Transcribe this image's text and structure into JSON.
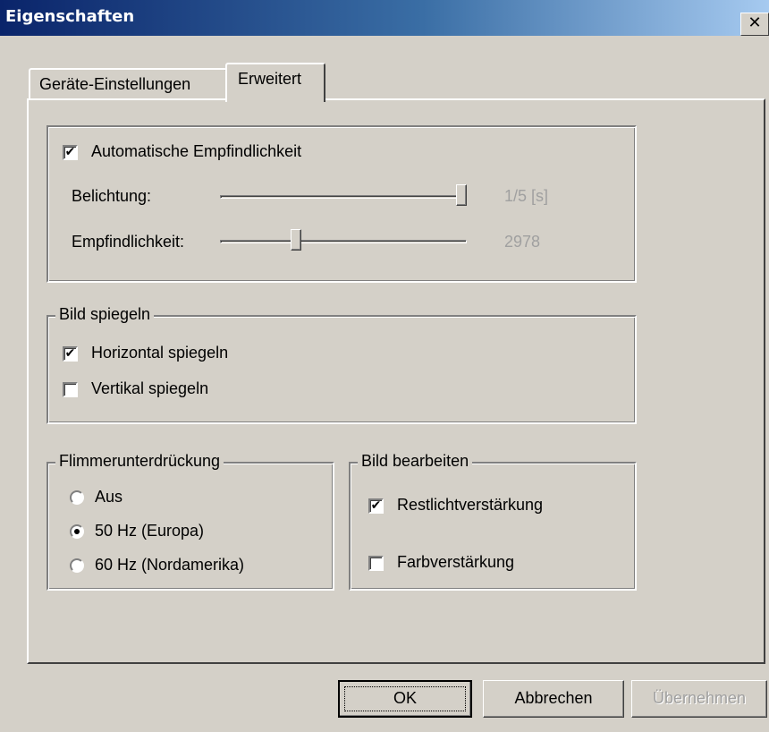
{
  "window": {
    "title": "Eigenschaften",
    "close_glyph": "✕",
    "close_icon": "close-icon"
  },
  "tabs": [
    {
      "label": "Geräte-Einstellungen",
      "active": false
    },
    {
      "label": "Erweitert",
      "active": true
    }
  ],
  "exposure_group": {
    "auto_sensitivity": {
      "label": "Automatische Empfindlichkeit",
      "checked": true,
      "mark": "✔"
    },
    "exposure": {
      "label": "Belichtung:",
      "value": "1/5 [s]",
      "level": 1.0
    },
    "sensitivity": {
      "label": "Empfindlichkeit:",
      "value": "2978",
      "level": 0.3
    }
  },
  "mirror_group": {
    "title": "Bild spiegeln",
    "horizontal": {
      "label": "Horizontal spiegeln",
      "checked": true,
      "mark": "✔"
    },
    "vertical": {
      "label": "Vertikal spiegeln",
      "checked": false,
      "mark": ""
    }
  },
  "flicker_group": {
    "title": "Flimmerunterdrückung",
    "options": [
      {
        "label": "Aus",
        "selected": false
      },
      {
        "label": "50 Hz (Europa)",
        "selected": true
      },
      {
        "label": "60 Hz (Nordamerika)",
        "selected": false
      }
    ]
  },
  "edit_group": {
    "title": "Bild bearbeiten",
    "lowlight": {
      "label": "Restlichtverstärkung",
      "checked": true,
      "mark": "✔"
    },
    "color": {
      "label": "Farbverstärkung",
      "checked": false,
      "mark": ""
    }
  },
  "buttons": {
    "ok": "OK",
    "cancel": "Abbrechen",
    "apply": "Übernehmen",
    "apply_enabled": false
  },
  "colors": {
    "titlebar_start": "#0a246a",
    "titlebar_end": "#a6caf0",
    "face": "#d4d0c8",
    "disabled_text": "#a0a0a0"
  }
}
